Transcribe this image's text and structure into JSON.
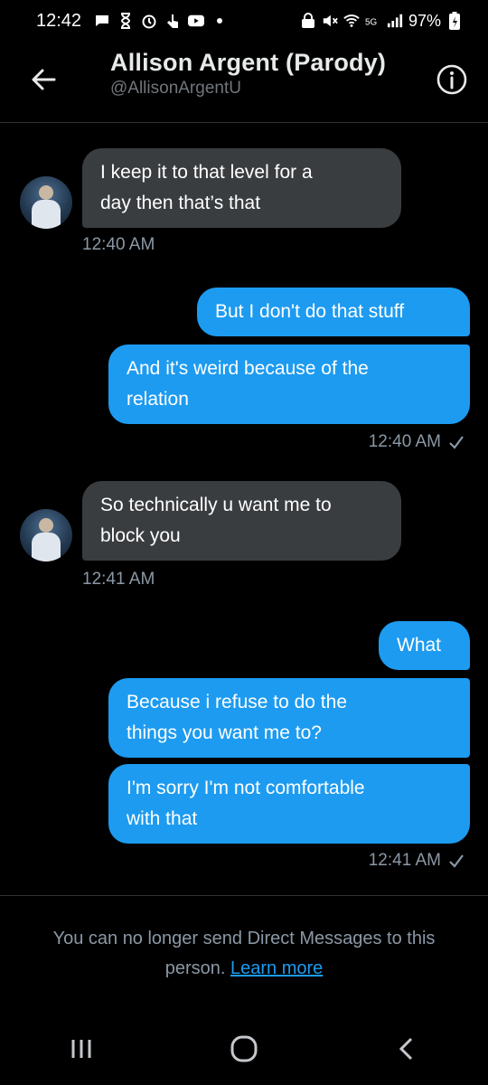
{
  "status_bar": {
    "time": "12:42",
    "battery": "97%"
  },
  "header": {
    "title": "Allison Argent (Parody)",
    "handle": "@AllisonArgentU"
  },
  "messages": [
    {
      "side": "in",
      "lines": [
        "I keep it to that level for a",
        "day then that’s that"
      ]
    },
    {
      "timestamp": "12:40 AM"
    },
    {
      "side": "out",
      "lines": [
        "But I don't do that stuff"
      ]
    },
    {
      "side": "out",
      "lines": [
        "And it's weird because of the",
        "relation"
      ]
    },
    {
      "timestamp": "12:40 AM"
    },
    {
      "side": "in",
      "lines": [
        "So technically u want me to",
        "block you"
      ]
    },
    {
      "timestamp": "12:41 AM"
    },
    {
      "side": "out",
      "lines": [
        "What"
      ]
    },
    {
      "side": "out",
      "lines": [
        "Because i refuse to do the",
        "things you want me to?"
      ]
    },
    {
      "side": "out",
      "lines": [
        "I'm sorry I'm not comfortable",
        "with that"
      ]
    },
    {
      "timestamp": "12:41 AM"
    }
  ],
  "footer": {
    "notice": "You can no longer send Direct Messages to this person.",
    "link": "Learn more"
  },
  "colors": {
    "accent": "#1d9bf0",
    "incoming_bubble": "#3a3d40",
    "background": "#000000",
    "muted_text": "#8b98a5"
  }
}
